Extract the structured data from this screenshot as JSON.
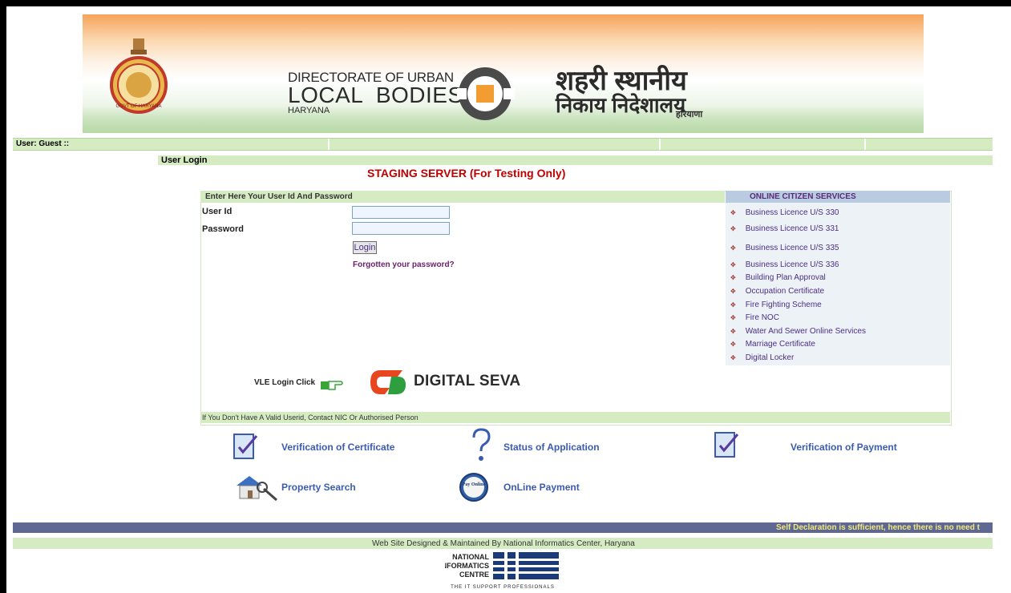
{
  "banner": {
    "org_en_line1": "DIRECTORATE OF URBAN",
    "org_en_line2": "LOCAL  BODIES",
    "org_en_line3": "HARYANA",
    "org_hi_line1": "शहरी स्थानीय",
    "org_hi_line2": "निकाय निदेशालय",
    "org_hi_line3": "हरियाणा",
    "emblem_text": "GOVT OF HARYANA"
  },
  "userbar": {
    "label": "User: Guest ::"
  },
  "page": {
    "section_title": "User Login",
    "staging_notice": "STAGING SERVER (For Testing Only)"
  },
  "login": {
    "header": "Enter Here Your User Id And Password",
    "userid_label": "User Id",
    "password_label": "Password",
    "userid_value": "",
    "password_value": "",
    "login_button": "Login",
    "forgot_link": "Forgotten your password?",
    "vle_label": "VLE Login Click",
    "digital_seva": "DIGITAL SEVA",
    "footer_note": "If You Don't Have A Valid Userid, Contact NIC Or Authorised Person"
  },
  "services": {
    "header": "ONLINE CITIZEN SERVICES",
    "items": [
      "Business Licence U/S 330",
      "Business Licence U/S 331",
      "Business Licence U/S 335",
      "Business Licence U/S 336",
      "Building Plan Approval",
      "Occupation Certificate",
      "Fire Fighting Scheme",
      "Fire NOC",
      "Water And Sewer Online Services",
      "Marriage Certificate",
      "Digital Locker"
    ]
  },
  "quick_links": {
    "verify_certificate": "Verification of Certificate",
    "status_application": "Status of Application",
    "verify_payment": "Verification of Payment",
    "property_search": "Property Search",
    "online_payment": "OnLine Payment",
    "pay_icon_text": "Pay Online"
  },
  "footer": {
    "ticker": "Self Declaration is sufficient, hence there is no need t",
    "credit": "Web Site Designed & Maintained By National Informatics Center, Haryana",
    "nic_line1": "NATIONAL",
    "nic_line2": "INFORMATICS",
    "nic_line3": "CENTRE",
    "nic_tagline": "THE IT SUPPORT PROFESSIONALS"
  }
}
